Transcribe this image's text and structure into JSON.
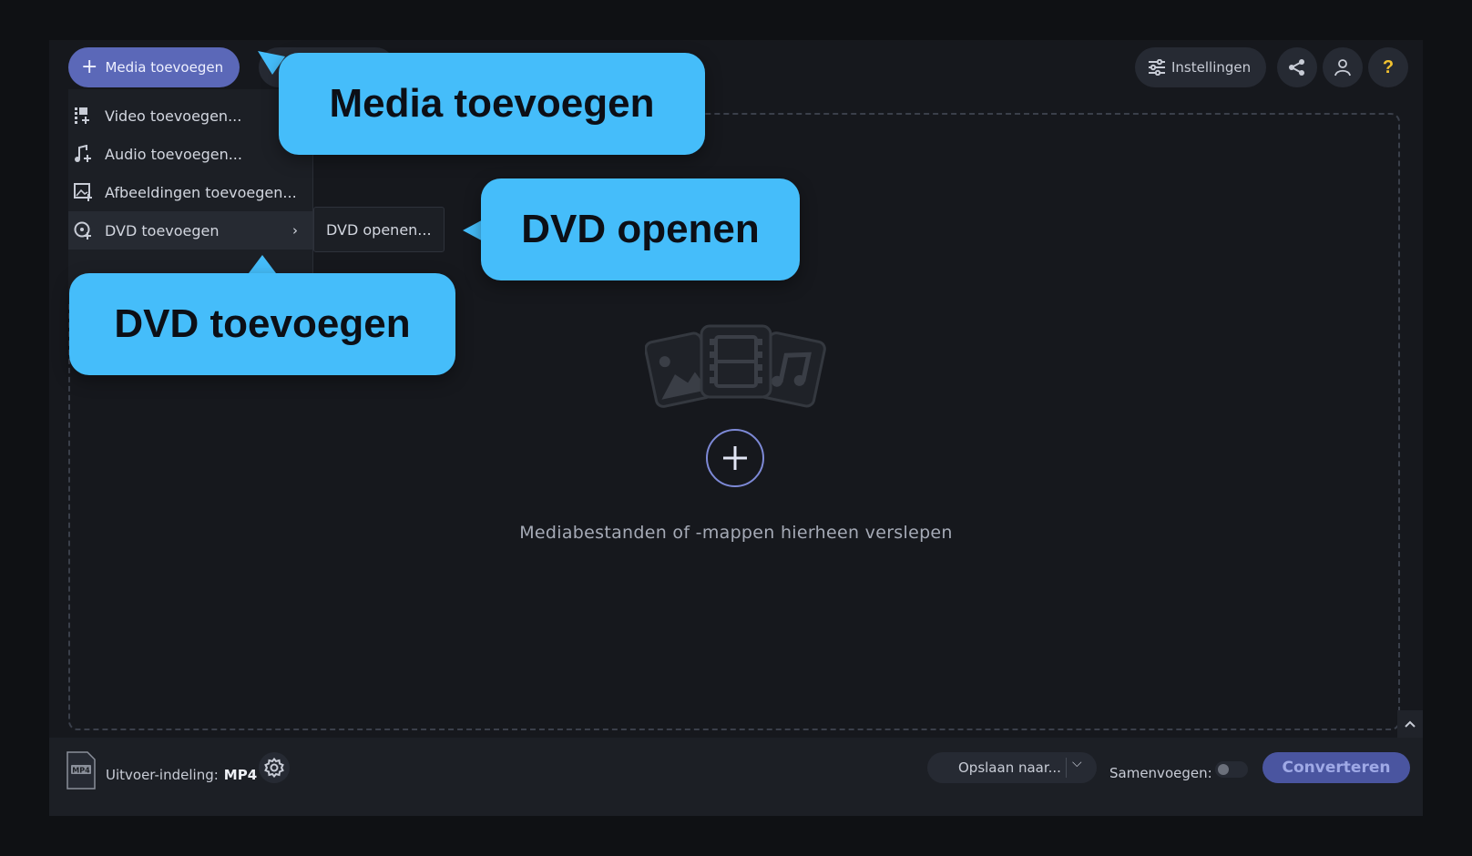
{
  "topbar": {
    "add_media_label": "Media toevoegen",
    "settings_label": "Instellingen"
  },
  "menu": {
    "items": [
      {
        "label": "Video toevoegen..."
      },
      {
        "label": "Audio toevoegen..."
      },
      {
        "label": "Afbeeldingen toevoegen..."
      },
      {
        "label": "DVD toevoegen"
      }
    ],
    "submenu_label": "DVD openen..."
  },
  "dropzone": {
    "hint": "Mediabestanden of -mappen hierheen verslepen"
  },
  "bottombar": {
    "output_label": "Uitvoer-indeling:",
    "output_value": "MP4",
    "format_icon_text": "MP4",
    "save_label": "Opslaan naar...",
    "merge_label": "Samenvoegen:",
    "convert_label": "Converteren"
  },
  "callouts": {
    "media": "Media toevoegen",
    "dvd_open": "DVD openen",
    "dvd_add": "DVD toevoegen"
  },
  "colors": {
    "accent": "#5b68b8",
    "callout": "#45bdfa",
    "help": "#f2c230",
    "background": "#16181d"
  },
  "icons": [
    "plus-icon",
    "sliders-icon",
    "share-icon",
    "user-icon",
    "help-icon",
    "video-add-icon",
    "audio-add-icon",
    "image-add-icon",
    "dvd-icon",
    "chevron-right-icon",
    "gear-icon",
    "mp4-file-icon",
    "chevron-up-icon",
    "chevron-down-icon"
  ]
}
